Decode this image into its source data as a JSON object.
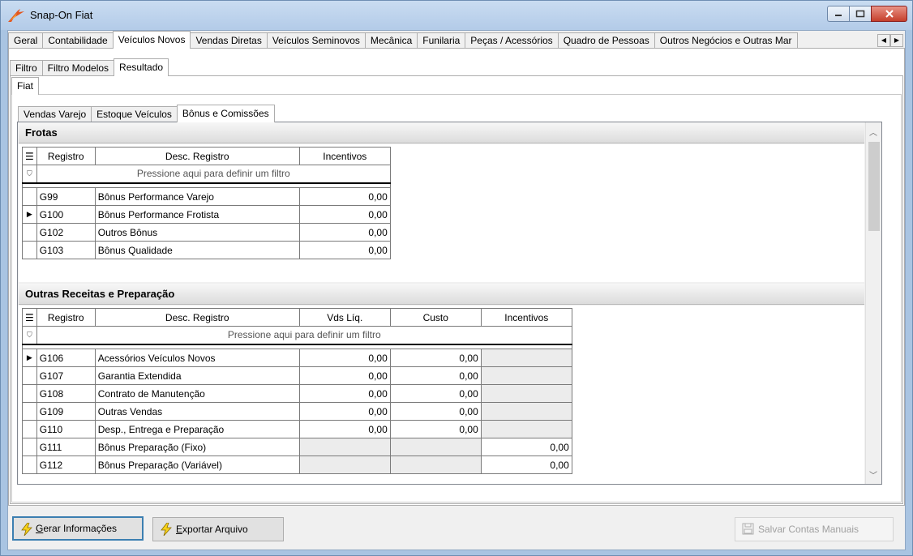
{
  "window": {
    "title": "Snap-On Fiat"
  },
  "main_tabs": [
    "Geral",
    "Contabilidade",
    "Veículos Novos",
    "Vendas Diretas",
    "Veículos Seminovos",
    "Mecânica",
    "Funilaria",
    "Peças / Acessórios",
    "Quadro de Pessoas",
    "Outros Negócios e Outras Mar"
  ],
  "main_tab_active": 2,
  "sub_tabs": [
    "Filtro",
    "Filtro Modelos",
    "Resultado"
  ],
  "sub_tab_active": 2,
  "brand_tabs": [
    "Fiat"
  ],
  "report_tabs": [
    "Vendas Varejo",
    "Estoque Veículos",
    "Bônus e Comissões"
  ],
  "report_tab_active": 2,
  "frotas": {
    "title": "Frotas",
    "columns": [
      "Registro",
      "Desc. Registro",
      "Incentivos"
    ],
    "filter_hint": "Pressione aqui para definir um filtro",
    "rows": [
      {
        "reg": "G99",
        "desc": "Bônus Performance Varejo",
        "inc": "0,00",
        "current": false
      },
      {
        "reg": "G100",
        "desc": "Bônus Performance Frotista",
        "inc": "0,00",
        "current": true
      },
      {
        "reg": "G102",
        "desc": "Outros Bônus",
        "inc": "0,00",
        "current": false
      },
      {
        "reg": "G103",
        "desc": "Bônus Qualidade",
        "inc": "0,00",
        "current": false
      }
    ]
  },
  "outras": {
    "title": "Outras Receitas e Preparação",
    "columns": [
      "Registro",
      "Desc. Registro",
      "Vds Líq.",
      "Custo",
      "Incentivos"
    ],
    "filter_hint": "Pressione aqui para definir um filtro",
    "rows": [
      {
        "reg": "G106",
        "desc": "Acessórios Veículos Novos",
        "vds": "0,00",
        "custo": "0,00",
        "inc": "",
        "current": true
      },
      {
        "reg": "G107",
        "desc": "Garantia Extendida",
        "vds": "0,00",
        "custo": "0,00",
        "inc": "",
        "current": false
      },
      {
        "reg": "G108",
        "desc": "Contrato de Manutenção",
        "vds": "0,00",
        "custo": "0,00",
        "inc": "",
        "current": false
      },
      {
        "reg": "G109",
        "desc": "Outras Vendas",
        "vds": "0,00",
        "custo": "0,00",
        "inc": "",
        "current": false
      },
      {
        "reg": "G110",
        "desc": "Desp., Entrega e Preparação",
        "vds": "0,00",
        "custo": "0,00",
        "inc": "",
        "current": false
      },
      {
        "reg": "G111",
        "desc": "Bônus Preparação (Fixo)",
        "vds": "",
        "custo": "",
        "inc": "0,00",
        "current": false
      },
      {
        "reg": "G112",
        "desc": "Bônus Preparação (Variável)",
        "vds": "",
        "custo": "",
        "inc": "0,00",
        "current": false
      }
    ]
  },
  "buttons": {
    "gerar_first": "G",
    "gerar_rest": "erar Informações",
    "exportar_first": "E",
    "exportar_rest": "xportar Arquivo",
    "salvar": "Salvar Contas Manuais"
  }
}
